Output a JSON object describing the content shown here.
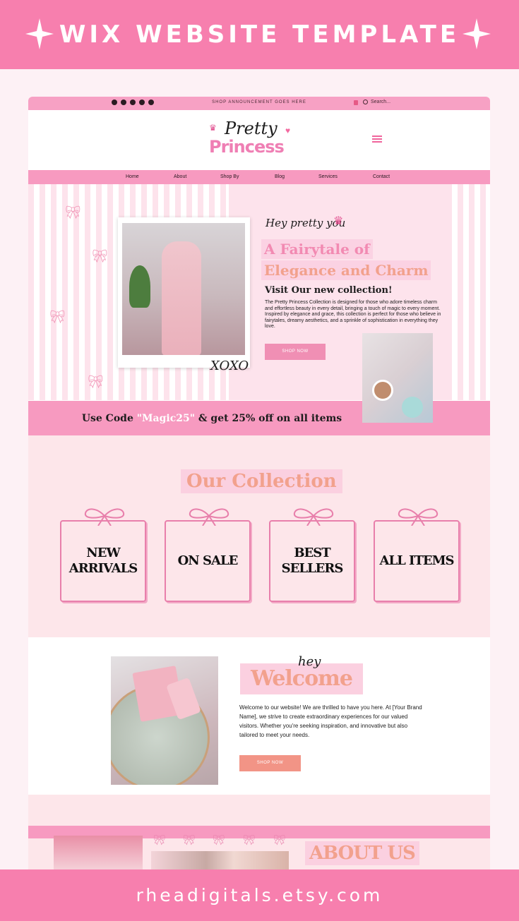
{
  "banner": {
    "title": "WIX WEBSITE TEMPLATE",
    "footer_url": "rheadigitals.etsy.com"
  },
  "topbar": {
    "announcement": "SHOP ANNOUNCEMENT GOES HERE",
    "search_placeholder": "Search...",
    "social_icons": [
      "instagram-icon",
      "facebook-icon",
      "x-icon",
      "youtube-icon",
      "pinterest-icon"
    ]
  },
  "logo": {
    "line1": "Pretty",
    "line2": "Princess"
  },
  "nav": {
    "items": [
      "Home",
      "About",
      "Shop By",
      "Blog",
      "Services",
      "Contact"
    ]
  },
  "hero": {
    "greeting": "Hey pretty you",
    "headline1": "A Fairytale of",
    "headline2": "Elegance and Charm",
    "subheading": "Visit Our new collection!",
    "body": "The Pretty Princess Collection is designed for those who adore timeless charm and effortless beauty in every detail, bringing a touch of magic to every moment. Inspired by elegance and grace, this collection is perfect for those who believe in fairytales, dreamy aesthetics, and a sprinkle of sophistication in everything they love.",
    "button": "SHOP NOW",
    "signature": "XOXO"
  },
  "promo": {
    "prefix": "Use Code ",
    "code": "\"Magic25\"",
    "suffix": " & get 25% off on all items"
  },
  "collection": {
    "title": "Our Collection",
    "categories": [
      {
        "line1": "NEW",
        "line2": "ARRIVALS"
      },
      {
        "line1": "ON SALE",
        "line2": ""
      },
      {
        "line1": "BEST",
        "line2": "SELLERS"
      },
      {
        "line1": "ALL ITEMS",
        "line2": ""
      }
    ]
  },
  "welcome": {
    "hey": "hey",
    "title": "Welcome",
    "body": "Welcome to our website! We are thrilled to have you here. At [Your Brand Name], we strive to create extraordinary experiences for our valued visitors. Whether you're seeking inspiration, and innovative but also tailored to meet your needs.",
    "button": "SHOP NOW"
  },
  "about": {
    "title": "ABOUT US"
  },
  "colors": {
    "brand_pink": "#f77fae",
    "light_pink": "#fde6ea",
    "peach": "#f2a18d",
    "accent_pink": "#f79ac0"
  }
}
